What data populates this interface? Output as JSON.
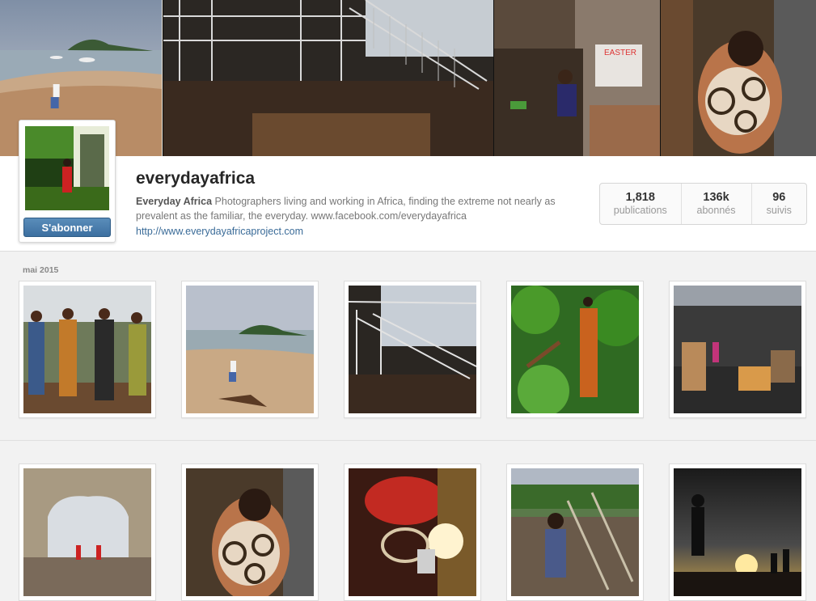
{
  "profile": {
    "username": "everydayafrica",
    "bio_name": "Everyday Africa",
    "bio_text": "Photographers living and working in Africa, finding the extreme not nearly as prevalent as the familiar, the everyday. www.facebook.com/everydayafrica",
    "website": "http://www.everydayafricaproject.com",
    "follow_label": "S'abonner"
  },
  "stats": [
    {
      "value": "1,818",
      "label": "publications"
    },
    {
      "value": "136k",
      "label": "abonnés"
    },
    {
      "value": "96",
      "label": "suivis"
    }
  ],
  "feed": {
    "section_date": "mai 2015"
  },
  "banner": {
    "poster_text": "EASTER"
  },
  "colors": {
    "accent": "#3c6fa0",
    "link": "#3a6b98",
    "background": "#f2f2f2"
  }
}
